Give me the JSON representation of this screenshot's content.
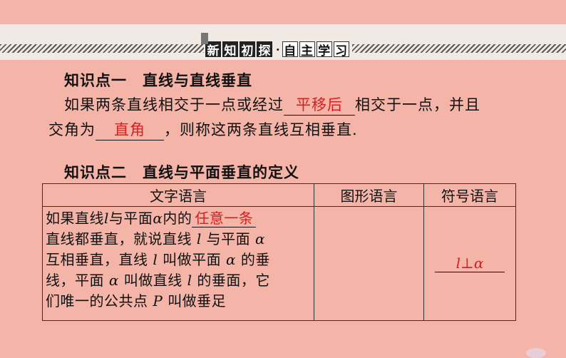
{
  "banner": {
    "chars_dark": [
      "新",
      "知",
      "初",
      "探"
    ],
    "separator": "·",
    "chars_light": [
      "自",
      "主",
      "学",
      "习"
    ]
  },
  "section1": {
    "heading": "知识点一　直线与直线垂直",
    "line1_pre": "如果两条直线相交于一点或经过",
    "blank1": "平移后",
    "line1_post": "相交于一点，并且",
    "line2_pre": "交角为",
    "blank2": "直角",
    "line2_post": "，则称这两条直线互相垂直."
  },
  "section2": {
    "heading": "知识点二　直线与平面垂直的定义",
    "table": {
      "headers": [
        "文字语言",
        "图形语言",
        "符号语言"
      ],
      "text_lines": {
        "l1_pre": "如果直线",
        "l1_var": "l",
        "l1_mid": "与平面",
        "l1_var2": "α",
        "l1_post": "内的",
        "l1_blank": "任意一条",
        "l2": "直线都垂直，就说直线",
        "l2_var": "l",
        "l2_mid": "与平面",
        "l2_var2": "α",
        "l3_pre": "互相垂直，直线",
        "l3_var": "l",
        "l3_mid": "叫做平面",
        "l3_var2": "α",
        "l3_post": "的垂",
        "l4_pre": "线，平面",
        "l4_var": "α",
        "l4_mid": "叫做直线",
        "l4_var2": "l",
        "l4_post": "的垂面，它",
        "l5_pre": "们唯一的公共点",
        "l5_var": "P",
        "l5_post": "叫做垂足"
      },
      "symbol": "l⊥α"
    }
  },
  "colors": {
    "background": "#f4b5a8",
    "answer_red": "#d42020"
  }
}
